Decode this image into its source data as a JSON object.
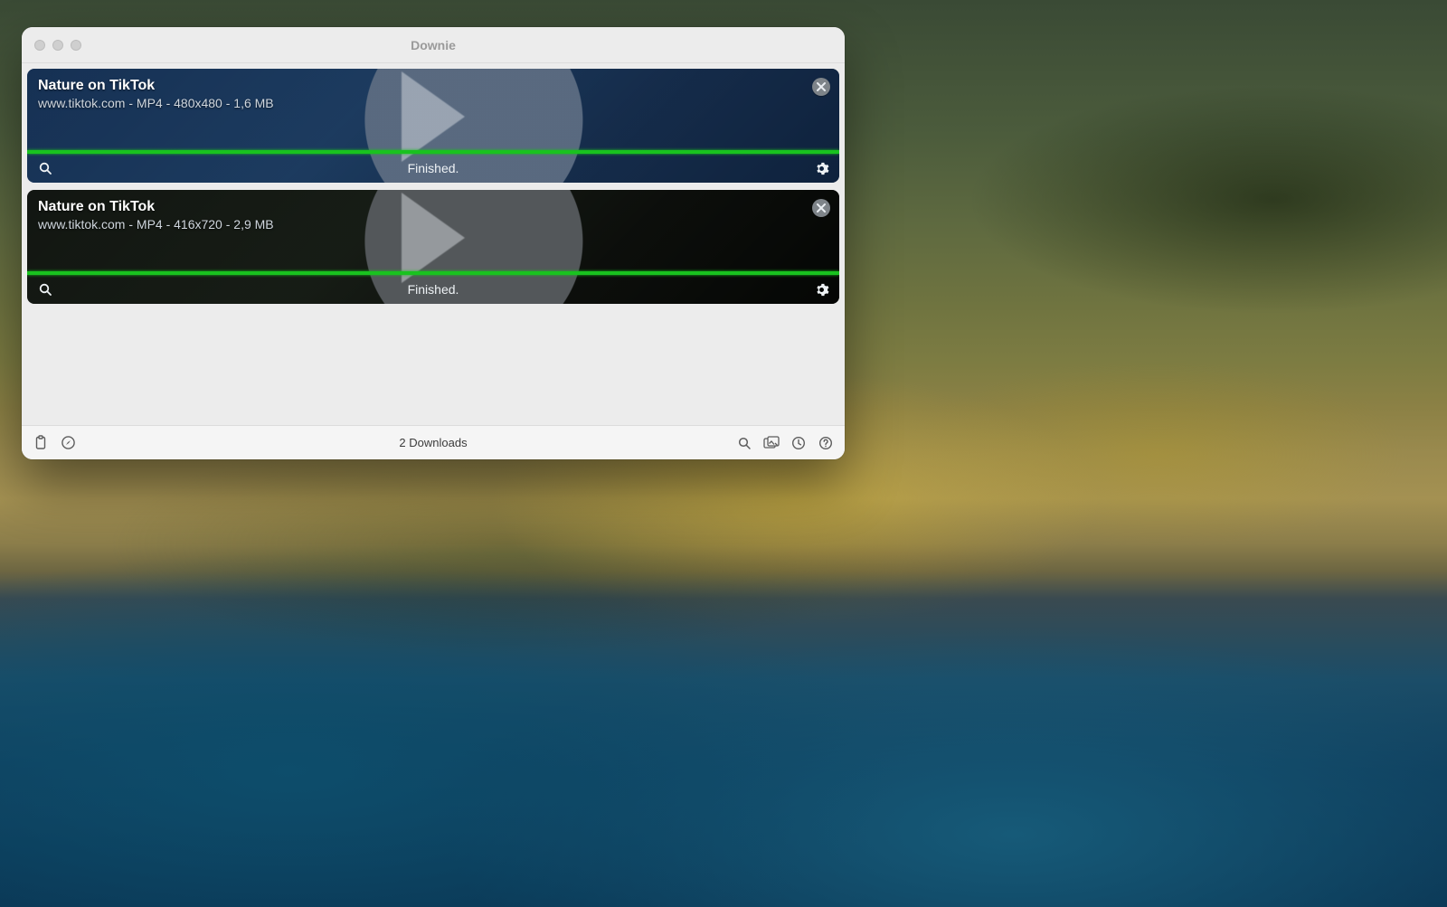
{
  "window": {
    "title": "Downie"
  },
  "downloads": [
    {
      "title": "Nature on TikTok",
      "meta": "www.tiktok.com - MP4 - 480x480 - 1,6 MB",
      "status": "Finished.",
      "progress_percent": 100
    },
    {
      "title": "Nature on TikTok",
      "meta": "www.tiktok.com - MP4 - 416x720 - 2,9 MB",
      "status": "Finished.",
      "progress_percent": 100
    }
  ],
  "footer": {
    "count_label": "2 Downloads"
  }
}
